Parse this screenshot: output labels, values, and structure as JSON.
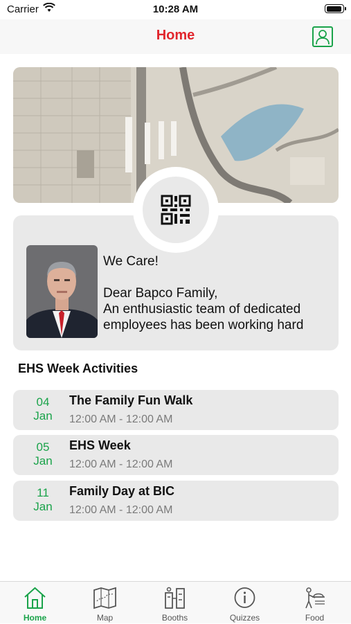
{
  "status_bar": {
    "carrier": "Carrier",
    "time": "10:28 AM"
  },
  "nav": {
    "title": "Home",
    "title_color": "#e1262d",
    "profile_icon": "profile-icon"
  },
  "banner": {
    "image": "aerial-map-image"
  },
  "message": {
    "qr_icon": "qr-code-icon",
    "lines": [
      "We Care!",
      "",
      "Dear Bapco Family,",
      "An enthusiastic team of dedicated",
      "employees has been working hard"
    ]
  },
  "activities": {
    "title": "EHS Week Activities",
    "items": [
      {
        "day": "04",
        "month": "Jan",
        "title": "The Family Fun Walk",
        "time": "12:00 AM - 12:00 AM"
      },
      {
        "day": "05",
        "month": "Jan",
        "title": "EHS Week",
        "time": "12:00 AM - 12:00 AM"
      },
      {
        "day": "11",
        "month": "Jan",
        "title": "Family Day at BIC",
        "time": "12:00 AM - 12:00 AM"
      }
    ]
  },
  "tabs": [
    {
      "label": "Home",
      "icon": "home-icon",
      "active": true
    },
    {
      "label": "Map",
      "icon": "map-icon",
      "active": false
    },
    {
      "label": "Booths",
      "icon": "booths-icon",
      "active": false
    },
    {
      "label": "Quizzes",
      "icon": "info-icon",
      "active": false
    },
    {
      "label": "Food",
      "icon": "food-icon",
      "active": false
    }
  ],
  "colors": {
    "accent": "#1aa34a",
    "title_red": "#e1262d",
    "card_bg": "#e9e9e9"
  }
}
